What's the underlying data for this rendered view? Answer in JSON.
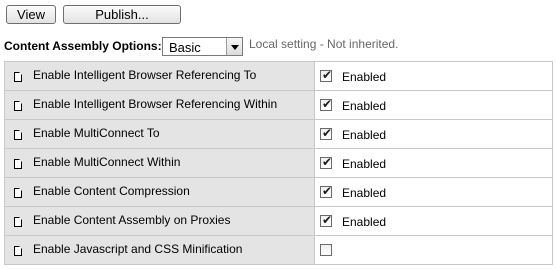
{
  "toolbar": {
    "view_label": "View",
    "publish_label": "Publish..."
  },
  "options": {
    "label": "Content Assembly Options:",
    "selected_value": "Basic",
    "local_setting_text": "Local setting - Not inherited."
  },
  "settings": [
    {
      "label": "Enable Intelligent Browser Referencing To",
      "checked": true,
      "value_text": "Enabled"
    },
    {
      "label": "Enable Intelligent Browser Referencing Within",
      "checked": true,
      "value_text": "Enabled"
    },
    {
      "label": "Enable MultiConnect To",
      "checked": true,
      "value_text": "Enabled"
    },
    {
      "label": "Enable MultiConnect Within",
      "checked": true,
      "value_text": "Enabled"
    },
    {
      "label": "Enable Content Compression",
      "checked": true,
      "value_text": "Enabled"
    },
    {
      "label": "Enable Content Assembly on Proxies",
      "checked": true,
      "value_text": "Enabled"
    },
    {
      "label": "Enable Javascript and CSS Minification",
      "checked": false,
      "value_text": ""
    }
  ]
}
